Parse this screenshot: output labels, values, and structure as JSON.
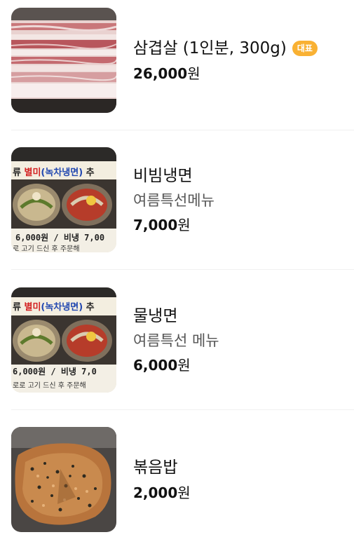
{
  "menu": [
    {
      "name": "삼겹살 (1인분, 300g)",
      "badge": "대표",
      "price_amount": "26,000",
      "price_unit": "원"
    },
    {
      "name": "비빔냉면",
      "description": "여름특선메뉴",
      "price_amount": "7,000",
      "price_unit": "원",
      "image_text": {
        "banner_prefix": "류 ",
        "banner_red": "별미",
        "banner_blue": "(녹차냉면)",
        "banner_suffix": " 추",
        "price_line": "6,000원 / 비냉 7,00",
        "bottom_line": "로 고기 드신 후 주문해"
      }
    },
    {
      "name": "물냉면",
      "description": "여름특선 메뉴",
      "price_amount": "6,000",
      "price_unit": "원",
      "image_text": {
        "banner_prefix": "류 ",
        "banner_red": "별미",
        "banner_blue": "(녹차냉면)",
        "banner_suffix": " 추",
        "price_line": "6,000원 / 비냉 7,0",
        "bottom_line": "로로 고기 드신 후 주문해"
      }
    },
    {
      "name": "볶음밥",
      "price_amount": "2,000",
      "price_unit": "원"
    }
  ]
}
